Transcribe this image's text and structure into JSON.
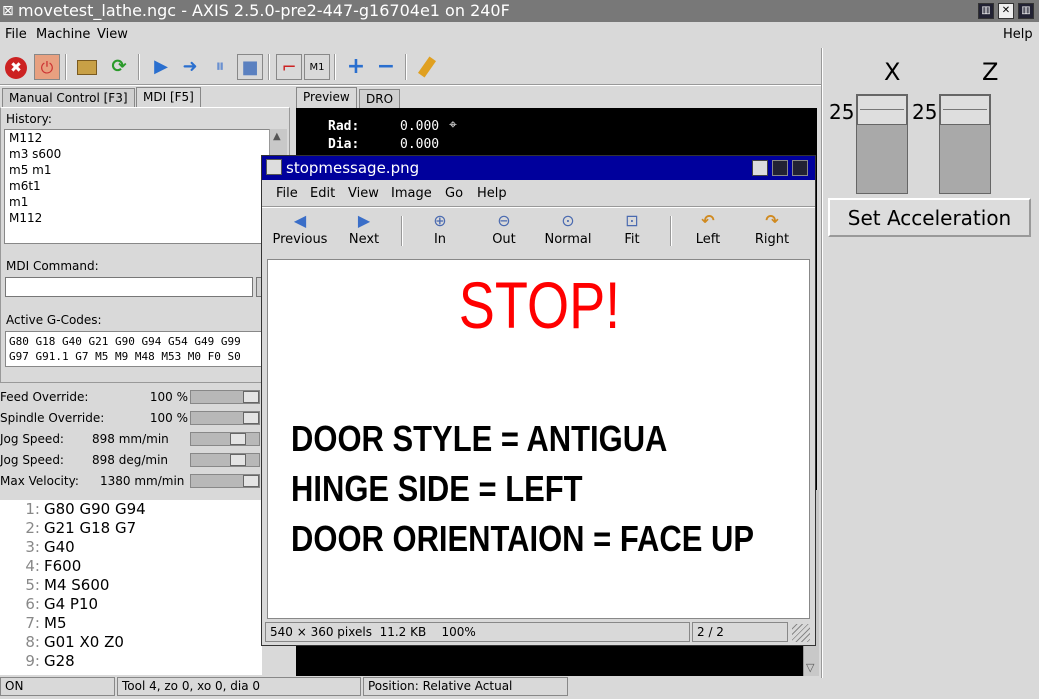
{
  "window": {
    "title": "movetest_lathe.ngc - AXIS 2.5.0-pre2-447-g16704e1 on 240F",
    "close_glyph": "✕",
    "maximize_glyph": "□"
  },
  "menu": {
    "file": "File",
    "machine": "Machine",
    "view": "View",
    "help": "Help"
  },
  "toolbar": {
    "estop": "✖",
    "power": "⏻",
    "open": "📂",
    "reload": "⟳",
    "run": "▶",
    "step": "➜",
    "pause": "⏸",
    "stop": "■",
    "toggle_display": "⌐",
    "block_delete": "M1",
    "zoom_in": "+",
    "zoom_out": "−",
    "clear": "🧹"
  },
  "left_tabs": [
    "Manual Control [F3]",
    "MDI [F5]"
  ],
  "right_tabs": [
    "Preview",
    "DRO"
  ],
  "mdi": {
    "history_label": "History:",
    "history": [
      "M112",
      "m3 s600",
      "m5 m1",
      "m6t1",
      "m1",
      "M112"
    ],
    "command_label": "MDI Command:",
    "command_value": "",
    "gcodes_label": "Active G-Codes:",
    "gcodes_line1": "G80 G18 G40 G21 G90 G94 G54 G49 G99",
    "gcodes_line2": "G97 G91.1 G7 M5 M9 M48 M53 M0 F0 S0"
  },
  "overrides": [
    {
      "name": "Feed Override:",
      "value": "100 %",
      "level": 1.0
    },
    {
      "name": "Spindle Override:",
      "value": "100 %",
      "level": 1.0
    },
    {
      "name": "Jog Speed:",
      "value": "898 mm/min",
      "level": 0.75
    },
    {
      "name": "Jog Speed:",
      "value": "898 deg/min",
      "level": 0.75
    },
    {
      "name": "Max Velocity:",
      "value": "1380 mm/min",
      "level": 1.0
    }
  ],
  "gcode_lines": [
    {
      "num": "1:",
      "text": "G80 G90 G94"
    },
    {
      "num": "2:",
      "text": "G21 G18 G7"
    },
    {
      "num": "3:",
      "text": "G40"
    },
    {
      "num": "4:",
      "text": "F600"
    },
    {
      "num": "5:",
      "text": "M4 S600"
    },
    {
      "num": "6:",
      "text": "G4 P10"
    },
    {
      "num": "7:",
      "text": "M5"
    },
    {
      "num": "8:",
      "text": "G01 X0 Z0"
    },
    {
      "num": "9:",
      "text": "G28"
    }
  ],
  "dro": {
    "rad_label": "Rad:",
    "rad_value": "0.000",
    "dia_label": "Dia:",
    "dia_value": "0.000"
  },
  "axis_panel": {
    "x_label": "X",
    "z_label": "Z",
    "x_value": "25",
    "z_value": "25",
    "button": "Set Acceleration"
  },
  "status": {
    "state": "ON",
    "tool": "Tool 4, zo 0, xo 0, dia 0",
    "position": "Position: Relative Actual"
  },
  "viewer": {
    "title": "stopmessage.png",
    "menu": [
      "File",
      "Edit",
      "View",
      "Image",
      "Go",
      "Help"
    ],
    "toolbar": [
      {
        "icon": "◀",
        "label": "Previous"
      },
      {
        "icon": "▶",
        "label": "Next"
      },
      {
        "icon": "⊕",
        "label": "In"
      },
      {
        "icon": "⊖",
        "label": "Out"
      },
      {
        "icon": "⊙",
        "label": "Normal"
      },
      {
        "icon": "⊡",
        "label": "Fit"
      },
      {
        "icon": "↶",
        "label": "Left"
      },
      {
        "icon": "↷",
        "label": "Right"
      }
    ],
    "image": {
      "stop": "STOP!",
      "line1": "DOOR STYLE = ANTIGUA",
      "line2": "HINGE SIDE = LEFT",
      "line3": "DOOR ORIENTAION = FACE UP"
    },
    "status_info": "540 × 360 pixels  11.2 KB    100%",
    "status_page": "2 / 2"
  },
  "colors": {
    "titlebar": "#787878",
    "viewer_titlebar": "#00009c",
    "stop_text": "#ff0000",
    "estop_red": "#cc2222",
    "run_blue": "#2a6fcf"
  }
}
